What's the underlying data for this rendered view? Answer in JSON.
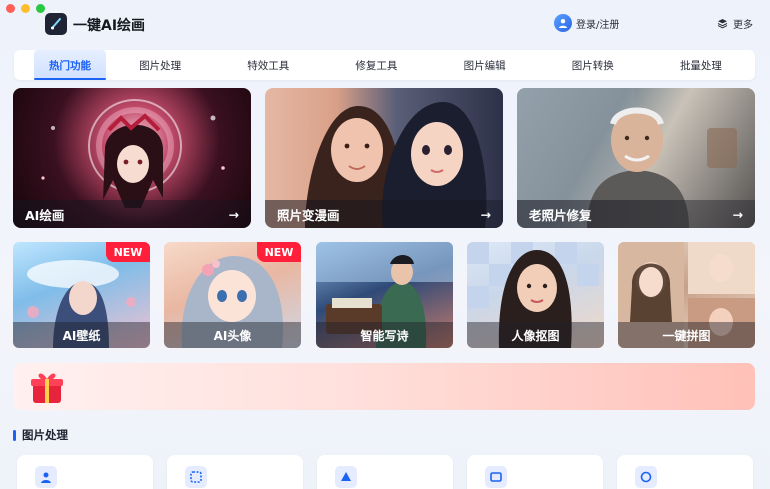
{
  "app": {
    "title": "一键AI绘画"
  },
  "header": {
    "login_label": "登录/注册",
    "more_label": "更多"
  },
  "tabs": [
    {
      "label": "热门功能",
      "active": true
    },
    {
      "label": "图片处理"
    },
    {
      "label": "特效工具"
    },
    {
      "label": "修复工具"
    },
    {
      "label": "图片编辑"
    },
    {
      "label": "图片转换"
    },
    {
      "label": "批量处理"
    }
  ],
  "featured": [
    {
      "label": "AI绘画",
      "icon": "arrow-right-icon"
    },
    {
      "label": "照片变漫画",
      "icon": "arrow-right-icon"
    },
    {
      "label": "老照片修复",
      "icon": "arrow-right-icon"
    }
  ],
  "features": [
    {
      "label": "AI壁纸",
      "badge": "NEW"
    },
    {
      "label": "AI头像",
      "badge": "NEW"
    },
    {
      "label": "智能写诗"
    },
    {
      "label": "人像抠图"
    },
    {
      "label": "一键拼图"
    }
  ],
  "banner": {
    "icon": "gift-box-icon"
  },
  "section": {
    "title": "图片处理"
  },
  "colors": {
    "accent": "#1b62f5",
    "badge": "#ff1f3a"
  }
}
